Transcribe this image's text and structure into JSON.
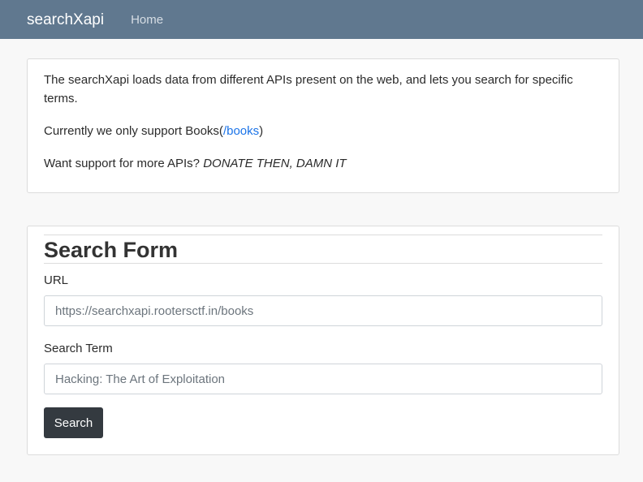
{
  "navbar": {
    "brand": "searchXapi",
    "home_link": "Home"
  },
  "info": {
    "line1": "The searchXapi loads data from different APIs present on the web, and lets you search for specific terms.",
    "line2_prefix": "Currently we only support Books(",
    "line2_link": "/books",
    "line2_suffix": ")",
    "line3_prefix": "Want support for more APIs? ",
    "line3_emphasis": "DONATE THEN, DAMN IT"
  },
  "form": {
    "title": "Search Form",
    "url_label": "URL",
    "url_placeholder": "https://searchxapi.rootersctf.in/books",
    "term_label": "Search Term",
    "term_placeholder": "Hacking: The Art of Exploitation",
    "submit_label": "Search"
  },
  "colors": {
    "navbar_bg": "#60788f",
    "link": "#1a73e8",
    "button_bg": "#343a40"
  }
}
